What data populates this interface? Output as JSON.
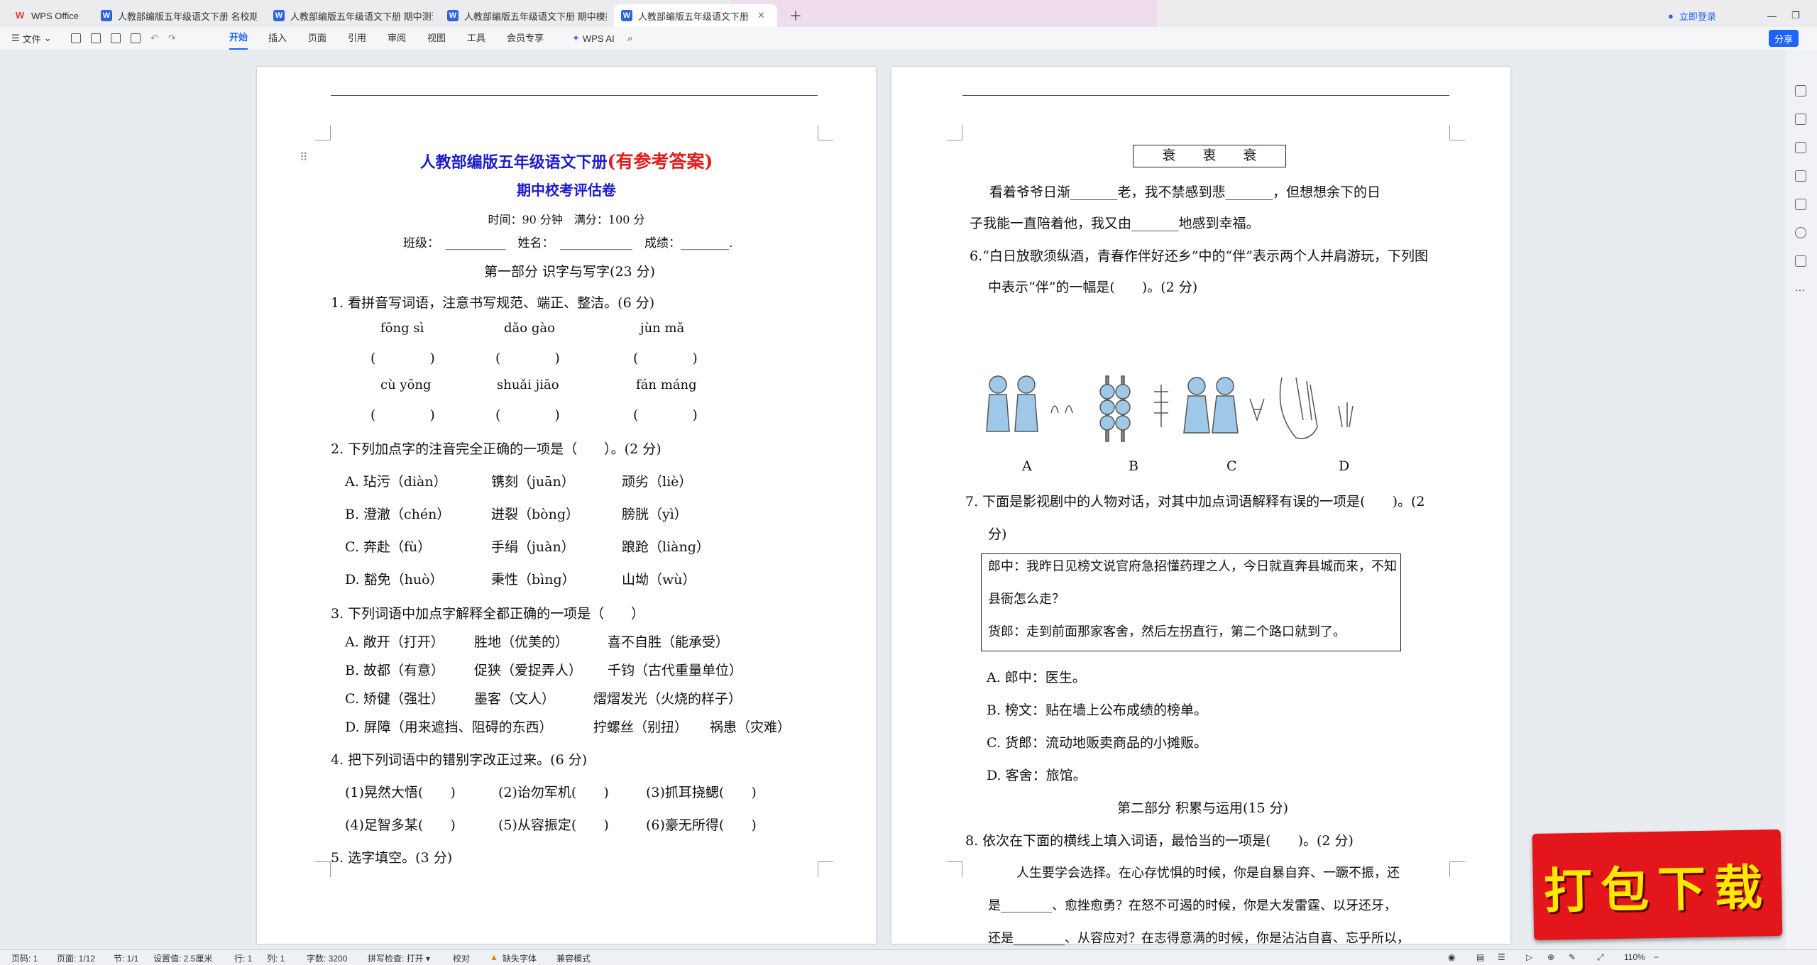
{
  "tabs": [
    "WPS Office",
    "人教部编版五年级语文下册 名校期中",
    "人教部编版五年级语文下册 期中测评",
    "人教部编版五年级语文下册 期中模拟",
    "人教部编版五年级语文下册 期"
  ],
  "topright": {
    "login": "立即登录",
    "share": "分享"
  },
  "toolbar": {
    "file": "文件",
    "ribbon": [
      "开始",
      "插入",
      "页面",
      "引用",
      "审阅",
      "视图",
      "工具",
      "会员专享"
    ],
    "ai": "WPS AI"
  },
  "page1": {
    "title": "人教部编版五年级语文下册",
    "title_red": "(有参考答案)",
    "subtitle": "期中校考评估卷",
    "time": "时间：90 分钟　满分：100 分",
    "info": "班级：　__________　姓名：　____________　成绩：________.",
    "part1": "第一部分  识字与写字(23 分)",
    "q1": "1.  看拼音写词语，注意书写规范、端正、整洁。(6 分)",
    "py1": [
      "fōng  sì",
      "dǎo  gào",
      "jùn  mǎ"
    ],
    "paren": "(　　　　)",
    "py2": [
      "cù  yōng",
      "shuǎi  jiāo",
      "fán  máng"
    ],
    "q2": "2. 下列加点字的注音完全正确的一项是（　　）。(2 分)",
    "q2a": [
      "A. 玷污（diàn）",
      "镌刻（juān）",
      "顽劣（liè）"
    ],
    "q2b": [
      "B. 澄澈（chén）",
      "迸裂（bòng）",
      "膀胱（yì）"
    ],
    "q2c": [
      "C. 奔赴（fù）",
      "手绢（juàn）",
      "踉跄（liàng）"
    ],
    "q2d": [
      "D. 豁免（huò）",
      "秉性（bìng）",
      "山坳（wù）"
    ],
    "q3": "3.  下列词语中加点字解释全都正确的一项是（　　）",
    "q3a": [
      "A. 敞开（打开）",
      "胜地（优美的）",
      "喜不自胜（能承受）"
    ],
    "q3b": [
      "B. 故都（有意）",
      "促狭（爱捉弄人）",
      "千钧（古代重量单位）"
    ],
    "q3c": [
      "C. 矫健（强壮）",
      "墨客（文人）",
      "熠熠发光（火烧的样子）"
    ],
    "q3d": [
      "D. 屏障（用来遮挡、阻碍的东西）",
      "拧螺丝（别扭）",
      "祸患（灾难）"
    ],
    "q4": "4.  把下列词语中的错别字改正过来。(6 分)",
    "q4r1": [
      "(1)晃然大悟(　　)",
      "(2)诒勿军机(　　)",
      "(3)抓耳挠鳃(　　)"
    ],
    "q4r2": [
      "(4)足智多某(　　)",
      "(5)从容振定(　　)",
      "(6)豪无所得(　　)"
    ],
    "q5": "5.  选字填空。(3 分)"
  },
  "page2": {
    "box": "衰　　衷　　衰",
    "l1": "看着爷爷日渐_______老，我不禁感到悲_______，但想想余下的日",
    "l2": "子我能一直陪着他，我又由_______地感到幸福。",
    "q6": "6.“白日放歌须纵酒，青春作伴好还乡”中的“伴”表示两个人并肩游玩，下列图",
    "q6b": "中表示“伴”的一幅是(　　)。(2 分)",
    "labels": [
      "A",
      "B",
      "C",
      "D"
    ],
    "q7": "7.  下面是影视剧中的人物对话，对其中加点词语解释有误的一项是(　　)。(2",
    "q7b": "分)",
    "d1": "郎中：我昨日见榜文说官府急招懂药理之人，今日就直奔县城而来，不知",
    "d2": "县衙怎么走？",
    "d3": "货郎：走到前面那家客舍，然后左拐直行，第二个路口就到了。",
    "q7a": "A.  郎中：医生。",
    "q7bb": "B.  榜文：贴在墙上公布成绩的榜单。",
    "q7c": "C.  货郎：流动地贩卖商品的小摊贩。",
    "q7d": "D.  客舍：旅馆。",
    "part2": "第二部分  积累与运用(15 分)",
    "q8": "8.  依次在下面的横线上填入词语，最恰当的一项是(　　)。(2 分)",
    "p1": "人生要学会选择。在心存忧惧的时候，你是自暴自弃、一蹶不振，还",
    "p2": "是________、愈挫愈勇？在怒不可遏的时候，你是大发雷霆、以牙还牙，",
    "p3": "还是________、从容应对？在志得意满的时候，你是沾沾自喜、忘乎所以，"
  },
  "banner": "打包下载",
  "status": {
    "page": "页码: 1",
    "pages": "页面: 1/12",
    "section": "节: 1/1",
    "setting": "设置值: 2.5厘米",
    "row": "行: 1",
    "col": "列: 1",
    "words": "字数: 3200",
    "spell": "拼写检查: 打开 ▾",
    "proof": "校对",
    "font": "缺失字体",
    "compat": "兼容模式",
    "zoom": "110%"
  }
}
